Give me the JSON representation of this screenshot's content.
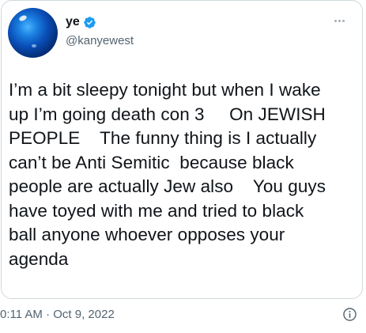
{
  "tweet": {
    "display_name": "ye",
    "handle": "@kanyewest",
    "verified": true,
    "text_lines": [
      "I’m a bit sleepy tonight but when I wake",
      "up I’m going death con 3     On JEWISH",
      "PEOPLE    The funny thing is I actually",
      "can’t be Anti Semitic  because black",
      "people are actually Jew also    You guys",
      "have toyed with me and tried to black",
      "ball anyone whoever opposes your",
      "agenda"
    ],
    "timestamp": "0:11 AM · Oct 9, 2022"
  },
  "icons": {
    "verified": "verified-badge-icon",
    "more": "more-options-icon",
    "info": "info-icon"
  },
  "colors": {
    "text_primary": "#0f1419",
    "text_secondary": "#536471",
    "verified_blue": "#1d9bf0",
    "border": "#cfd9de"
  }
}
